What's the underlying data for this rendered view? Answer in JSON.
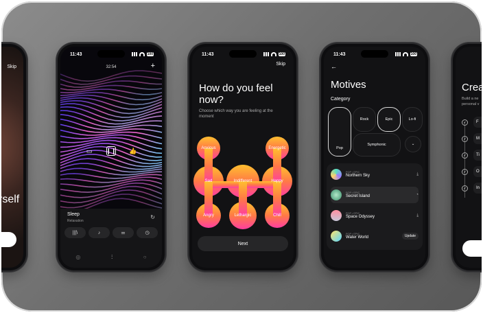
{
  "phones": {
    "p1": {
      "title": "rself",
      "skip": "Skip"
    },
    "p2": {
      "time": "11:43",
      "timer": "32:54",
      "plus": "+",
      "track": "Sleep",
      "subtitle": "Relaxation",
      "icons": [
        "comment-icon",
        "pause-icon",
        "like-icon"
      ]
    },
    "p3": {
      "time": "11:43",
      "skip": "Skip",
      "title": "How do you feel now?",
      "subtitle": "Choose which way you are feeling at the moment",
      "moods": [
        "Anxious",
        "Energetic",
        "Sad",
        "Indifferent",
        "Happy",
        "Angry",
        "Lethargic",
        "Chill"
      ],
      "next": "Next"
    },
    "p4": {
      "time": "11:43",
      "title": "Motives",
      "category": "Category",
      "categories": [
        "Pop",
        "Rock",
        "Epic",
        "Lo-fi",
        "Symphonic"
      ],
      "tracks": [
        {
          "tag": "POP • EPIC",
          "name": "Northern Sky"
        },
        {
          "tag": "POP • EPIC",
          "name": "Secret Island"
        },
        {
          "tag": "POP • EPIC",
          "name": "Space Odyssey"
        },
        {
          "tag": "POP • EPIC",
          "name": "Water World"
        }
      ],
      "update": "Update"
    },
    "p5": {
      "title": "Crea",
      "sub1": "Build a ne",
      "sub2": "personal v",
      "items": [
        "F",
        "M",
        "Ti",
        "O",
        "In"
      ]
    }
  },
  "colors": {
    "accent_yellow": "#f5c21b",
    "accent_orange": "#ff8a3a",
    "accent_pink": "#ff3fa1",
    "accent_magenta": "#d93bd7"
  }
}
